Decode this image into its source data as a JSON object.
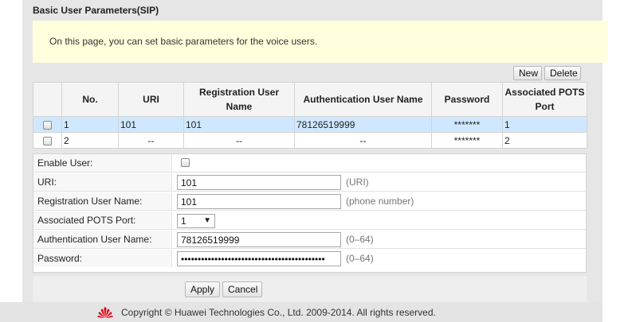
{
  "page": {
    "title": "Basic User Parameters(SIP)",
    "info": "On this page, you can set basic parameters for the voice users."
  },
  "toolbar": {
    "new_label": "New",
    "delete_label": "Delete"
  },
  "table": {
    "headers": [
      "No.",
      "URI",
      "Registration User Name",
      "Authentication User Name",
      "Password",
      "Associated POTS Port"
    ],
    "rows": [
      {
        "no": "1",
        "uri": "101",
        "reg_user": "101",
        "auth_user": "78126519999",
        "password": "*******",
        "port": "1"
      },
      {
        "no": "2",
        "uri": "--",
        "reg_user": "--",
        "auth_user": "--",
        "password": "*******",
        "port": "2"
      }
    ]
  },
  "form": {
    "enable_label": "Enable User:",
    "uri_label": "URI:",
    "uri_value": "101",
    "uri_hint": "(URI)",
    "reg_label": "Registration User Name:",
    "reg_value": "101",
    "reg_hint": "(phone number)",
    "port_label": "Associated POTS Port:",
    "port_value": "1",
    "auth_label": "Authentication User Name:",
    "auth_value": "78126519999",
    "auth_hint": "(0–64)",
    "pwd_label": "Password:",
    "pwd_value": "1234567890123456789012345678901234567890123",
    "pwd_hint": "(0–64)"
  },
  "actions": {
    "apply_label": "Apply",
    "cancel_label": "Cancel"
  },
  "footer": {
    "copyright": "Copyright © Huawei Technologies Co., Ltd. 2009-2014. All rights reserved."
  },
  "colors": {
    "accent_selected_row": "#cfe8ff",
    "info_bg": "#ffffdd",
    "logo_red": "#e60012"
  },
  "icons": {
    "footer_logo": "huawei-logo-icon",
    "dropdown": "chevron-down-icon"
  }
}
